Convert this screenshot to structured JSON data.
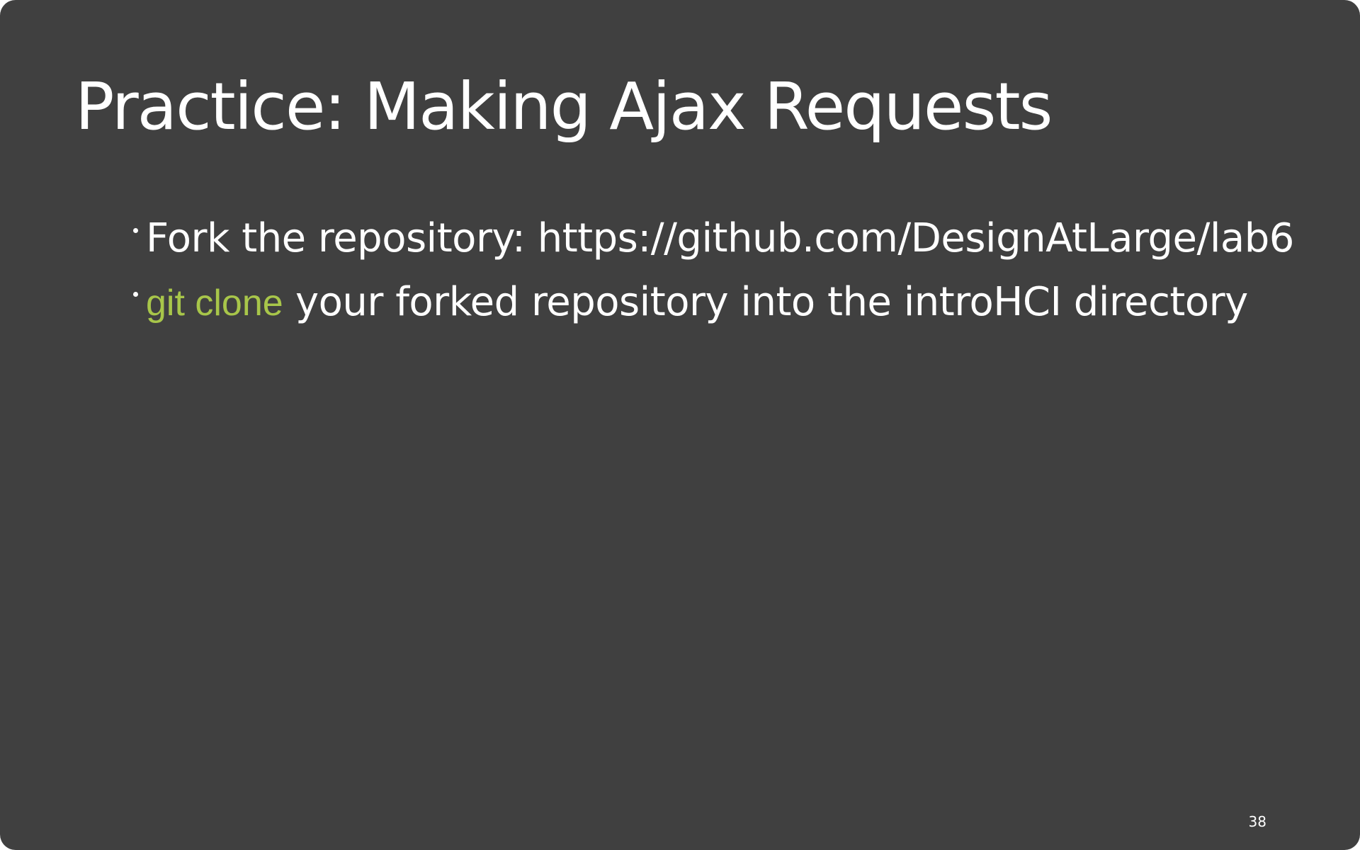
{
  "slide": {
    "title": "Practice: Making Ajax Requests",
    "bullets": [
      {
        "text": "Fork the repository: https://github.com/DesignAtLarge/lab6"
      },
      {
        "code": "git clone",
        "text": " your forked repository into the introHCI directory"
      }
    ],
    "page_number": "38",
    "colors": {
      "background": "#404040",
      "text": "#ffffff",
      "code": "#a8c64a"
    }
  }
}
